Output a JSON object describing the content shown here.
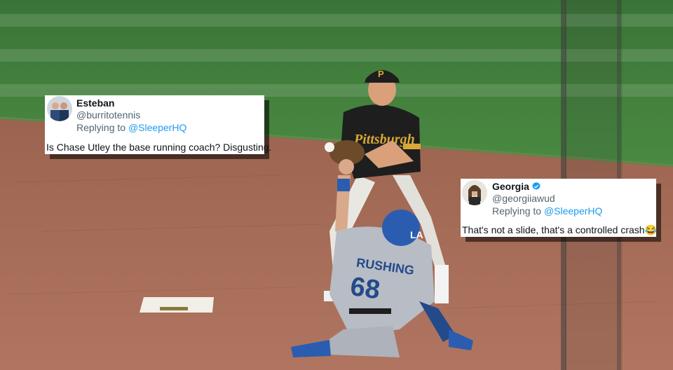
{
  "scene": {
    "description_icon": "baseball-double-play-slide",
    "pitcher_cap_letter": "P",
    "runner_name": "RUSHING",
    "runner_number": "68",
    "colors": {
      "grass": "#3f7a3a",
      "dirt": "#a46b55",
      "pirates_black": "#1e1e1e",
      "pirates_gold": "#d8a838",
      "dodgers_blue": "#2a5db0",
      "road_gray": "#b8bcc4"
    }
  },
  "tweets": [
    {
      "name": "Esteban",
      "handle": "@burritotennis",
      "replying_prefix": "Replying to ",
      "replying_to": "@SleeperHQ",
      "text": "Is Chase Utley the base running coach? Disgusting.",
      "verified": false
    },
    {
      "name": "Georgia",
      "handle": "@georgiiawud",
      "replying_prefix": "Replying to ",
      "replying_to": "@SleeperHQ",
      "text": "That's not a slide, that's a controlled crash😂",
      "verified": true
    }
  ]
}
